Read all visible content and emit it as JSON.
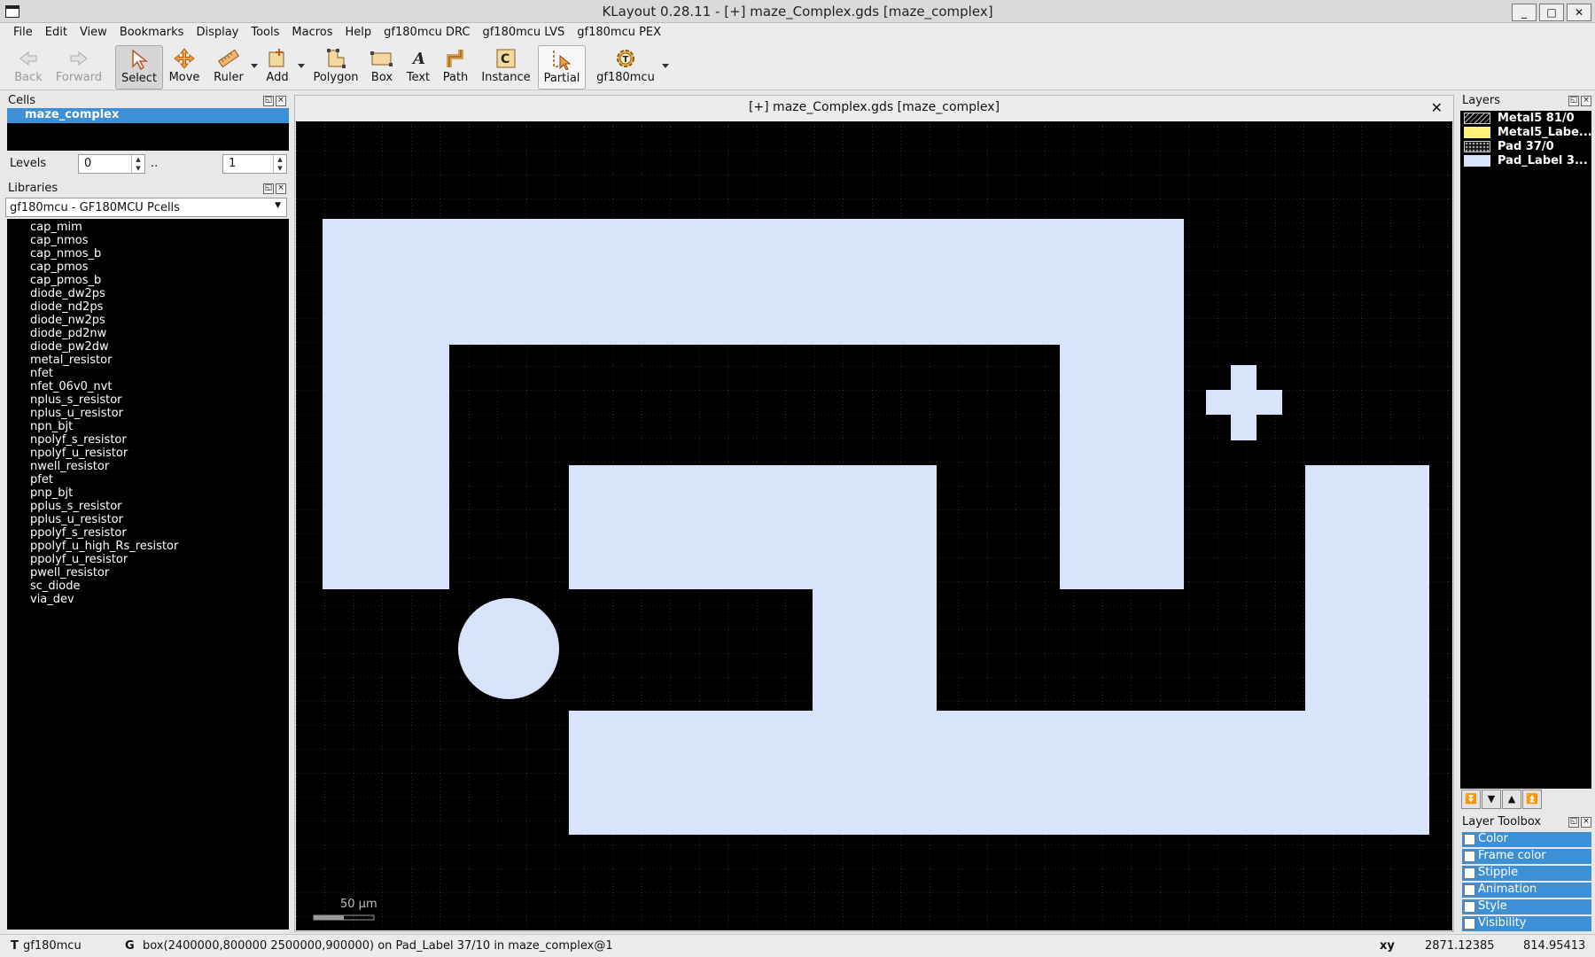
{
  "window": {
    "title": "KLayout 0.28.11 - [+] maze_Complex.gds [maze_complex]",
    "minimize": "_",
    "maximize": "□",
    "close": "✕"
  },
  "menu": [
    "File",
    "Edit",
    "View",
    "Bookmarks",
    "Display",
    "Tools",
    "Macros",
    "Help",
    "gf180mcu DRC",
    "gf180mcu LVS",
    "gf180mcu PEX"
  ],
  "toolbar": {
    "back": "Back",
    "forward": "Forward",
    "select": "Select",
    "move": "Move",
    "ruler": "Ruler",
    "add": "Add",
    "polygon": "Polygon",
    "box": "Box",
    "text": "Text",
    "path": "Path",
    "instance": "Instance",
    "partial": "Partial",
    "gf180mcu": "gf180mcu"
  },
  "cells_panel": {
    "title": "Cells",
    "selected_cell": "maze_complex"
  },
  "levels": {
    "label": "Levels",
    "from": "0",
    "sep": "..",
    "to": "1"
  },
  "libraries": {
    "title": "Libraries",
    "selected": "gf180mcu - GF180MCU Pcells",
    "items": [
      "cap_mim",
      "cap_nmos",
      "cap_nmos_b",
      "cap_pmos",
      "cap_pmos_b",
      "diode_dw2ps",
      "diode_nd2ps",
      "diode_nw2ps",
      "diode_pd2nw",
      "diode_pw2dw",
      "metal_resistor",
      "nfet",
      "nfet_06v0_nvt",
      "nplus_s_resistor",
      "nplus_u_resistor",
      "npn_bjt",
      "npolyf_s_resistor",
      "npolyf_u_resistor",
      "nwell_resistor",
      "pfet",
      "pnp_bjt",
      "pplus_s_resistor",
      "pplus_u_resistor",
      "ppolyf_s_resistor",
      "ppolyf_u_high_Rs_resistor",
      "ppolyf_u_resistor",
      "pwell_resistor",
      "sc_diode",
      "via_dev"
    ]
  },
  "canvas": {
    "tab_title": "[+] maze_Complex.gds [maze_complex]",
    "close": "✕",
    "scale_label": "50 µm",
    "fill_color": "#d8e4fb",
    "background_color": "#000000"
  },
  "layers": {
    "title": "Layers",
    "items": [
      {
        "name": "Metal5 81/0",
        "swatch": "#1a1a1a",
        "pattern": "hatch"
      },
      {
        "name": "Metal5_Labe...",
        "swatch": "#fff27a",
        "pattern": "solid"
      },
      {
        "name": "Pad 37/0",
        "swatch": "#111111",
        "pattern": "dots"
      },
      {
        "name": "Pad_Label 3...",
        "swatch": "#d8e4fb",
        "pattern": "solid"
      }
    ]
  },
  "layer_toolbox": {
    "title": "Layer Toolbox",
    "items": [
      "Color",
      "Frame color",
      "Stipple",
      "Animation",
      "Style",
      "Visibility"
    ]
  },
  "status": {
    "mode_key": "T",
    "tech": "gf180mcu",
    "g_key": "G",
    "message": "box(2400000,800000 2500000,900000) on Pad_Label 37/10 in maze_complex@1",
    "xy_label": "xy",
    "x": "2871.12385",
    "y": "814.95413"
  }
}
